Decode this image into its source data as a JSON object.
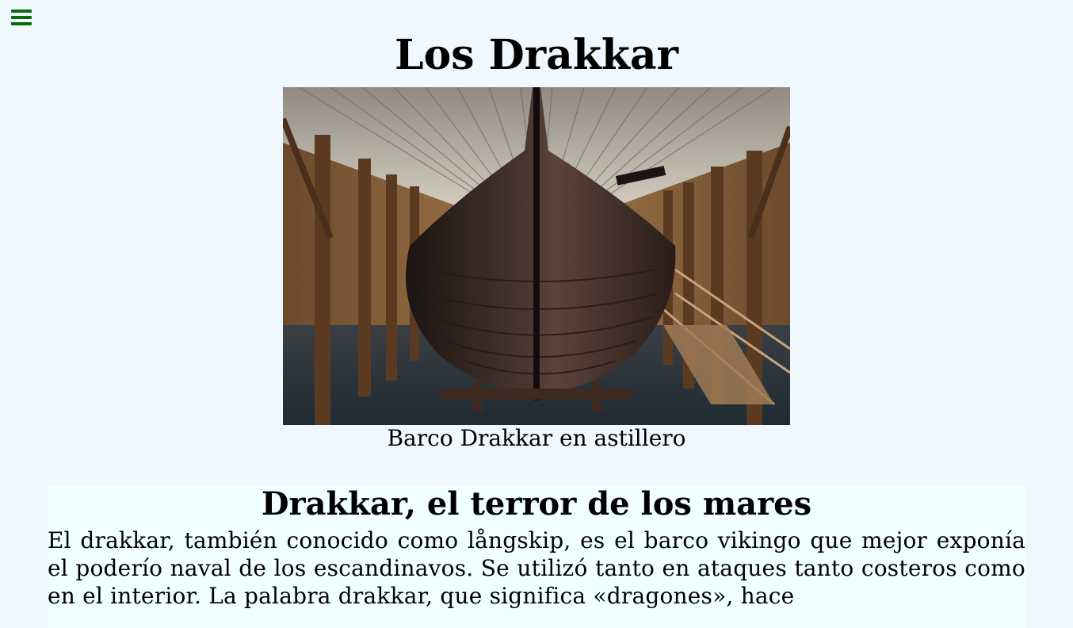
{
  "nav": {
    "menu_icon": "hamburger-menu-icon",
    "menu_color": "#0a6b0a"
  },
  "header": {
    "title": "Los Drakkar"
  },
  "hero": {
    "image_alt": "Barco Drakkar en astillero",
    "caption": "Barco Drakkar en astillero"
  },
  "section": {
    "heading": "Drakkar, el terror de los mares",
    "paragraph": "El drakkar, también conocido como långskip, es el barco vikingo que mejor exponía el poderío naval de los escandinavos. Se utilizó tanto en ataques tanto costeros como en el interior. La palabra drakkar, que significa «dragones», hace"
  },
  "colors": {
    "page_bg": "#f0f8ff",
    "section_bg": "#f0ffff"
  }
}
